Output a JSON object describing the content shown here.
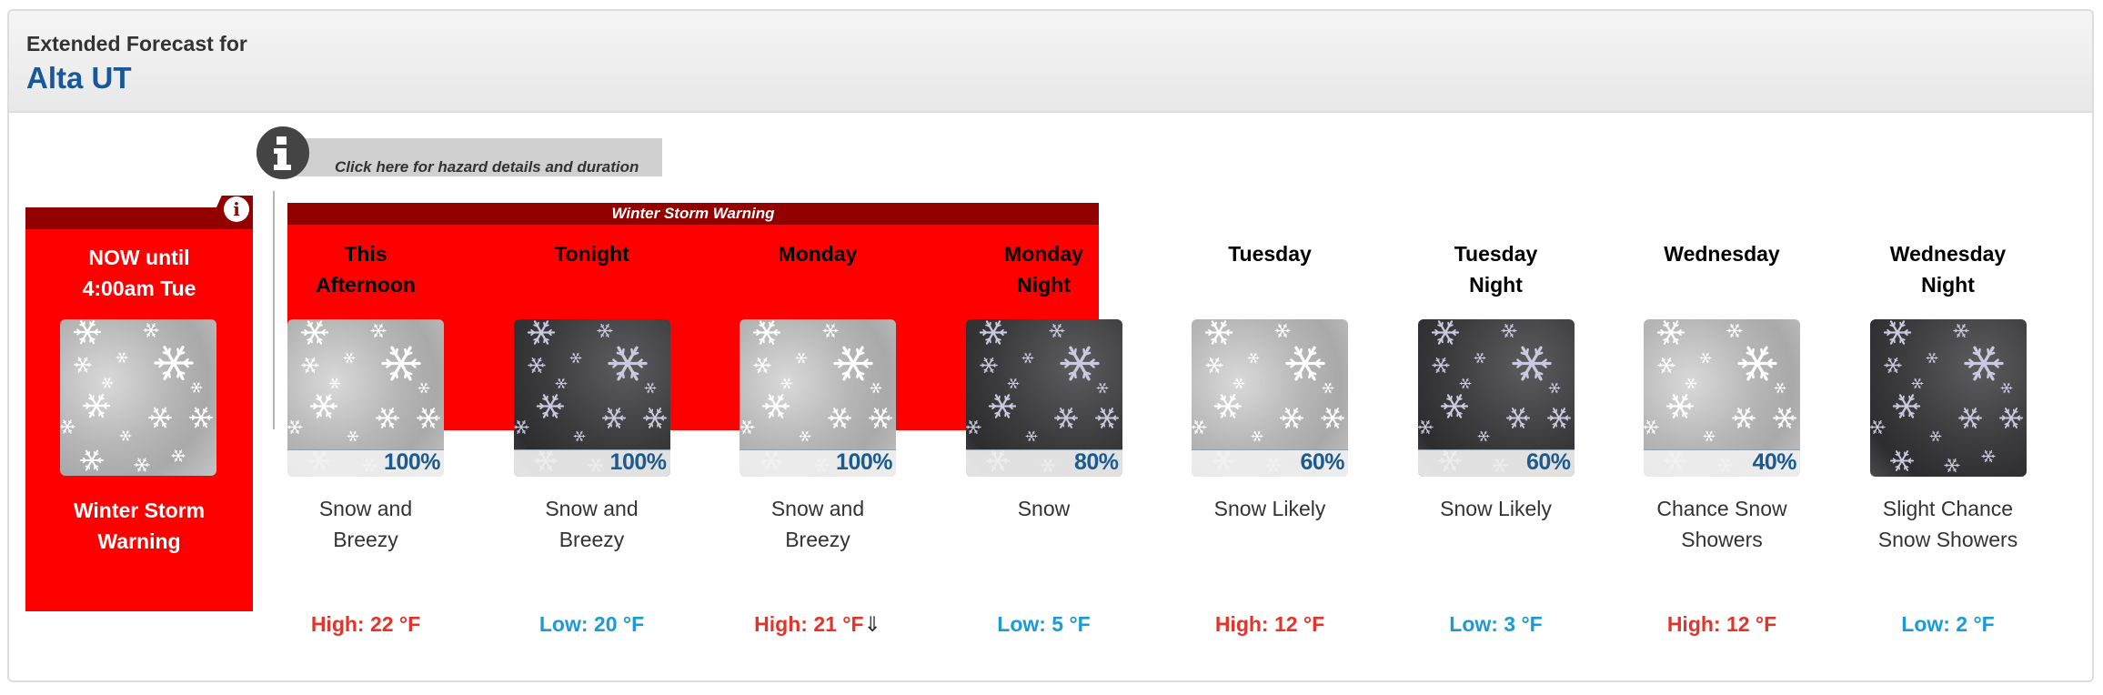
{
  "header": {
    "subtitle": "Extended Forecast for",
    "location": "Alta UT"
  },
  "hazard_link": {
    "icon": "info-icon",
    "label": "Click here for hazard details and duration"
  },
  "now_box": {
    "period": "NOW until 4:00am Tue",
    "period_line1": "NOW until",
    "period_line2": "4:00am Tue",
    "label_line1": "Winter Storm",
    "label_line2": "Warning",
    "icon": "info-icon",
    "image": "snow-day"
  },
  "warning_banner": {
    "label": "Winter Storm Warning",
    "color": "#ff0000",
    "header_color": "#920000"
  },
  "colors": {
    "high": "#e2342b",
    "low": "#1d9ad6",
    "title": "#18579a",
    "pop": "#1c5b8f"
  },
  "periods": [
    {
      "name_line1": "This",
      "name_line2": "Afternoon",
      "image": "snow-day",
      "pop": "100%",
      "desc_line1": "Snow and",
      "desc_line2": "Breezy",
      "temp_type": "hi",
      "temp": "High: 22 °F",
      "trend": ""
    },
    {
      "name_line1": "Tonight",
      "name_line2": "",
      "image": "snow-night",
      "pop": "100%",
      "desc_line1": "Snow and",
      "desc_line2": "Breezy",
      "temp_type": "lo",
      "temp": "Low: 20 °F",
      "trend": ""
    },
    {
      "name_line1": "Monday",
      "name_line2": "",
      "image": "snow-day",
      "pop": "100%",
      "desc_line1": "Snow and",
      "desc_line2": "Breezy",
      "temp_type": "hi",
      "temp": "High: 21 °F",
      "trend": "⇓"
    },
    {
      "name_line1": "Monday",
      "name_line2": "Night",
      "image": "snow-night",
      "pop": "80%",
      "desc_line1": "Snow",
      "desc_line2": "",
      "temp_type": "lo",
      "temp": "Low: 5 °F",
      "trend": ""
    },
    {
      "name_line1": "Tuesday",
      "name_line2": "",
      "image": "snow-day",
      "pop": "60%",
      "desc_line1": "Snow Likely",
      "desc_line2": "",
      "temp_type": "hi",
      "temp": "High: 12 °F",
      "trend": ""
    },
    {
      "name_line1": "Tuesday",
      "name_line2": "Night",
      "image": "snow-night",
      "pop": "60%",
      "desc_line1": "Snow Likely",
      "desc_line2": "",
      "temp_type": "lo",
      "temp": "Low: 3 °F",
      "trend": ""
    },
    {
      "name_line1": "Wednesday",
      "name_line2": "",
      "image": "snow-day",
      "pop": "40%",
      "desc_line1": "Chance Snow",
      "desc_line2": "Showers",
      "temp_type": "hi",
      "temp": "High: 12 °F",
      "trend": ""
    },
    {
      "name_line1": "Wednesday",
      "name_line2": "Night",
      "image": "snow-night",
      "pop": "",
      "desc_line1": "Slight Chance",
      "desc_line2": "Snow Showers",
      "temp_type": "lo",
      "temp": "Low: 2 °F",
      "trend": ""
    }
  ]
}
